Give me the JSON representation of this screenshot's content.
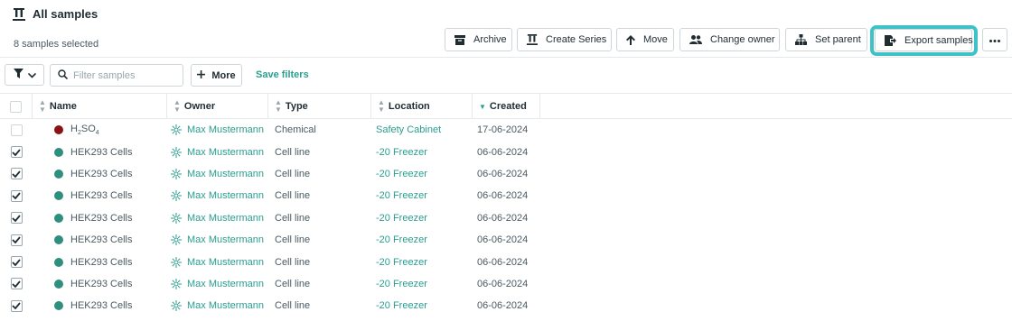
{
  "header": {
    "title": "All samples",
    "selected_count": "8 samples selected"
  },
  "actions": {
    "archive": "Archive",
    "create_series": "Create Series",
    "move": "Move",
    "change_owner": "Change owner",
    "set_parent": "Set parent",
    "export_samples": "Export samples"
  },
  "toolbar": {
    "search_placeholder": "Filter samples",
    "more": "More",
    "save_filters": "Save filters"
  },
  "columns": {
    "name": "Name",
    "owner": "Owner",
    "type": "Type",
    "location": "Location",
    "created": "Created"
  },
  "colors": {
    "accent": "#2a9d8f",
    "highlight_ring": "#3ec2c8",
    "chemical_dot": "#8b1212",
    "cell_line_dot": "#2e8f7e"
  },
  "rows": [
    {
      "checked": false,
      "name": "H",
      "name_sub": "2",
      "name_mid": "SO",
      "name_sub2": "4",
      "dot": "#8b1212",
      "owner": "Max Mustermann",
      "type": "Chemical",
      "location": "Safety Cabinet",
      "created": "17-06-2024"
    },
    {
      "checked": true,
      "name": "HEK293 Cells",
      "dot": "#2e8f7e",
      "owner": "Max Mustermann",
      "type": "Cell line",
      "location": "-20 Freezer",
      "created": "06-06-2024"
    },
    {
      "checked": true,
      "name": "HEK293 Cells",
      "dot": "#2e8f7e",
      "owner": "Max Mustermann",
      "type": "Cell line",
      "location": "-20 Freezer",
      "created": "06-06-2024"
    },
    {
      "checked": true,
      "name": "HEK293 Cells",
      "dot": "#2e8f7e",
      "owner": "Max Mustermann",
      "type": "Cell line",
      "location": "-20 Freezer",
      "created": "06-06-2024"
    },
    {
      "checked": true,
      "name": "HEK293 Cells",
      "dot": "#2e8f7e",
      "owner": "Max Mustermann",
      "type": "Cell line",
      "location": "-20 Freezer",
      "created": "06-06-2024"
    },
    {
      "checked": true,
      "name": "HEK293 Cells",
      "dot": "#2e8f7e",
      "owner": "Max Mustermann",
      "type": "Cell line",
      "location": "-20 Freezer",
      "created": "06-06-2024"
    },
    {
      "checked": true,
      "name": "HEK293 Cells",
      "dot": "#2e8f7e",
      "owner": "Max Mustermann",
      "type": "Cell line",
      "location": "-20 Freezer",
      "created": "06-06-2024"
    },
    {
      "checked": true,
      "name": "HEK293 Cells",
      "dot": "#2e8f7e",
      "owner": "Max Mustermann",
      "type": "Cell line",
      "location": "-20 Freezer",
      "created": "06-06-2024"
    },
    {
      "checked": true,
      "name": "HEK293 Cells",
      "dot": "#2e8f7e",
      "owner": "Max Mustermann",
      "type": "Cell line",
      "location": "-20 Freezer",
      "created": "06-06-2024"
    }
  ]
}
